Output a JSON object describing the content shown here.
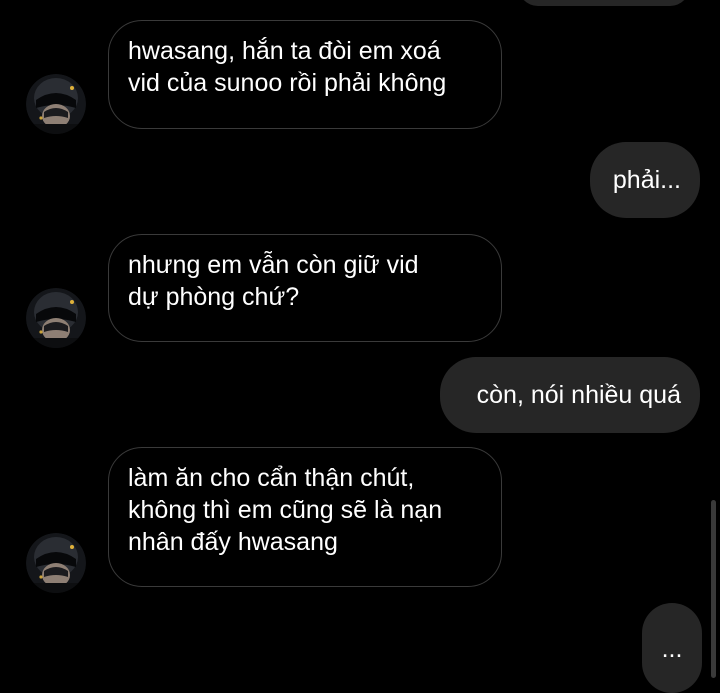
{
  "messages": [
    {
      "sender": "other",
      "text": "hwasang, hắn ta đòi em xoá\nvid của sunoo rồi phải không"
    },
    {
      "sender": "me",
      "text": "phải..."
    },
    {
      "sender": "other",
      "text": "nhưng em vẫn còn giữ vid\ndự phòng chứ?"
    },
    {
      "sender": "me",
      "text": "còn, nói nhiều quá"
    },
    {
      "sender": "other",
      "text": "làm ăn cho cẩn thận chút,\nkhông thì em cũng sẽ là nạn\nnhân đấy hwasang"
    }
  ],
  "typing_indicator": "...",
  "colors": {
    "background": "#000000",
    "incoming_border": "#3a3a3a",
    "outgoing_fill": "#262626",
    "text": "#ffffff"
  }
}
